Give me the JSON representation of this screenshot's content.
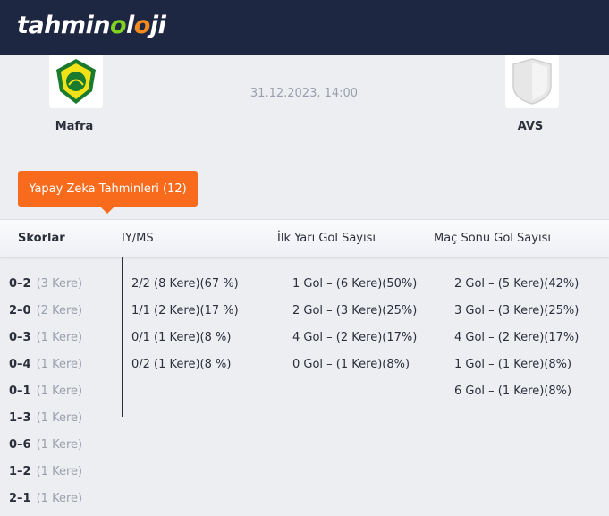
{
  "brand": {
    "part1": "tahmin",
    "part2": "o",
    "part3": "l",
    "part4": "o",
    "part5": "ji"
  },
  "match": {
    "home_team": "Mafra",
    "away_team": "AVS",
    "datetime": "31.12.2023, 14:00"
  },
  "ai_tab": {
    "label": "Yapay Zeka Tahminleri (12)"
  },
  "columns": {
    "scores": "Skorlar",
    "iyms": "IY/MS",
    "first_half": "İlk Yarı Gol Sayısı",
    "full_time": "Maç Sonu Gol Sayısı"
  },
  "scores": [
    {
      "score": "0–2",
      "count": "(3 Kere)"
    },
    {
      "score": "2–0",
      "count": "(2 Kere)"
    },
    {
      "score": "0–3",
      "count": "(1 Kere)"
    },
    {
      "score": "0–4",
      "count": "(1 Kere)"
    },
    {
      "score": "0–1",
      "count": "(1 Kere)"
    },
    {
      "score": "1–3",
      "count": "(1 Kere)"
    },
    {
      "score": "0–6",
      "count": "(1 Kere)"
    },
    {
      "score": "1–2",
      "count": "(1 Kere)"
    },
    {
      "score": "2–1",
      "count": "(1 Kere)"
    }
  ],
  "iyms": [
    "2/2 (8 Kere)(67 %)",
    "1/1 (2 Kere)(17 %)",
    "0/1 (1 Kere)(8 %)",
    "0/2 (1 Kere)(8 %)"
  ],
  "first_half": [
    "1 Gol – (6 Kere)(50%)",
    "2 Gol – (3 Kere)(25%)",
    "4 Gol – (2 Kere)(17%)",
    "0 Gol – (1 Kere)(8%)"
  ],
  "full_time": [
    "2 Gol – (5 Kere)(42%)",
    "3 Gol – (3 Kere)(25%)",
    "4 Gol – (2 Kere)(17%)",
    "1 Gol – (1 Kere)(8%)",
    "6 Gol – (1 Kere)(8%)"
  ]
}
